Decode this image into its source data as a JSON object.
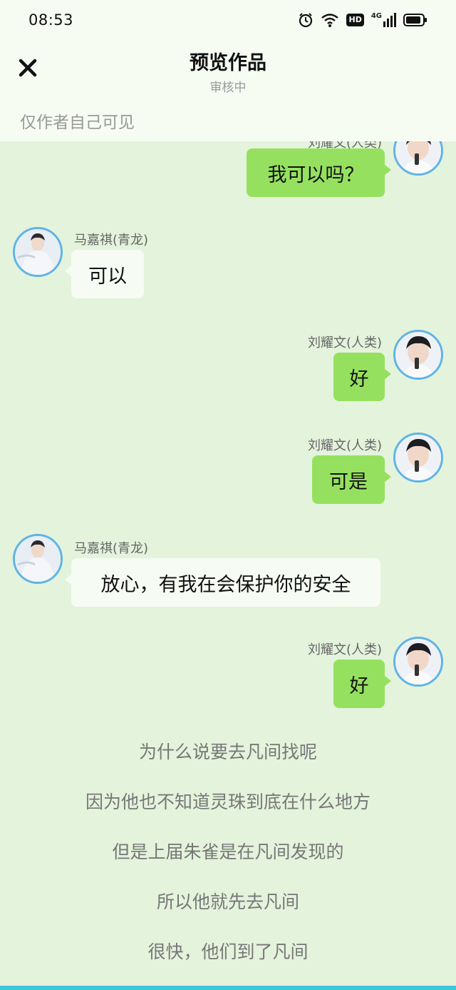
{
  "status_bar": {
    "time": "08:53",
    "icons": [
      "alarm-icon",
      "wifi-icon",
      "hd-icon",
      "signal-4g-icon",
      "battery-icon"
    ],
    "network": "4G",
    "hd": "HD"
  },
  "header": {
    "title": "预览作品",
    "subtitle": "审核中",
    "visibility_note": "仅作者自己可见",
    "close_icon": "close-icon"
  },
  "colors": {
    "background": "#e4f3dc",
    "header_bg": "#f7fcf3",
    "green_bubble": "#95e15f",
    "white_bubble": "#f6fbf4",
    "avatar_border": "#5fb4e6",
    "bottom_accent": "#3ec6e0"
  },
  "messages": [
    {
      "side": "right",
      "name": "刘耀文(人类)",
      "text": "我可以吗？"
    },
    {
      "side": "left",
      "name": "马嘉祺(青龙)",
      "text": "可以"
    },
    {
      "side": "right",
      "name": "刘耀文(人类)",
      "text": "好"
    },
    {
      "side": "right",
      "name": "刘耀文(人类)",
      "text": "可是"
    },
    {
      "side": "left",
      "name": "马嘉祺(青龙)",
      "text": "放心，有我在会保护你的安全"
    },
    {
      "side": "right",
      "name": "刘耀文(人类)",
      "text": "好"
    }
  ],
  "narration": [
    "为什么说要去凡间找呢",
    "因为他也不知道灵珠到底在什么地方",
    "但是上届朱雀是在凡间发现的",
    "所以他就先去凡间",
    "很快，他们到了凡间"
  ]
}
